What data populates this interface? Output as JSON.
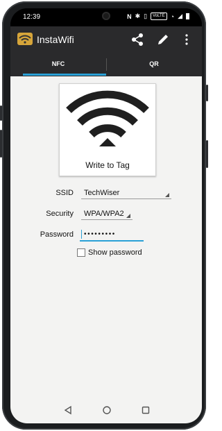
{
  "status_bar": {
    "time": "12:39",
    "volte": "VoLTE"
  },
  "app": {
    "title": "InstaWifi"
  },
  "tabs": [
    {
      "label": "NFC"
    },
    {
      "label": "QR"
    }
  ],
  "tag": {
    "caption": "Write to Tag"
  },
  "form": {
    "ssid": {
      "label": "SSID",
      "value": "TechWiser"
    },
    "security": {
      "label": "Security",
      "value": "WPA/WPA2"
    },
    "password": {
      "label": "Password",
      "value": "•••••••••"
    },
    "show_password": {
      "label": "Show password",
      "checked": false
    }
  },
  "colors": {
    "accent": "#29a0d6",
    "app_bar": "#2a2a2c",
    "background": "#f3f3f2"
  }
}
